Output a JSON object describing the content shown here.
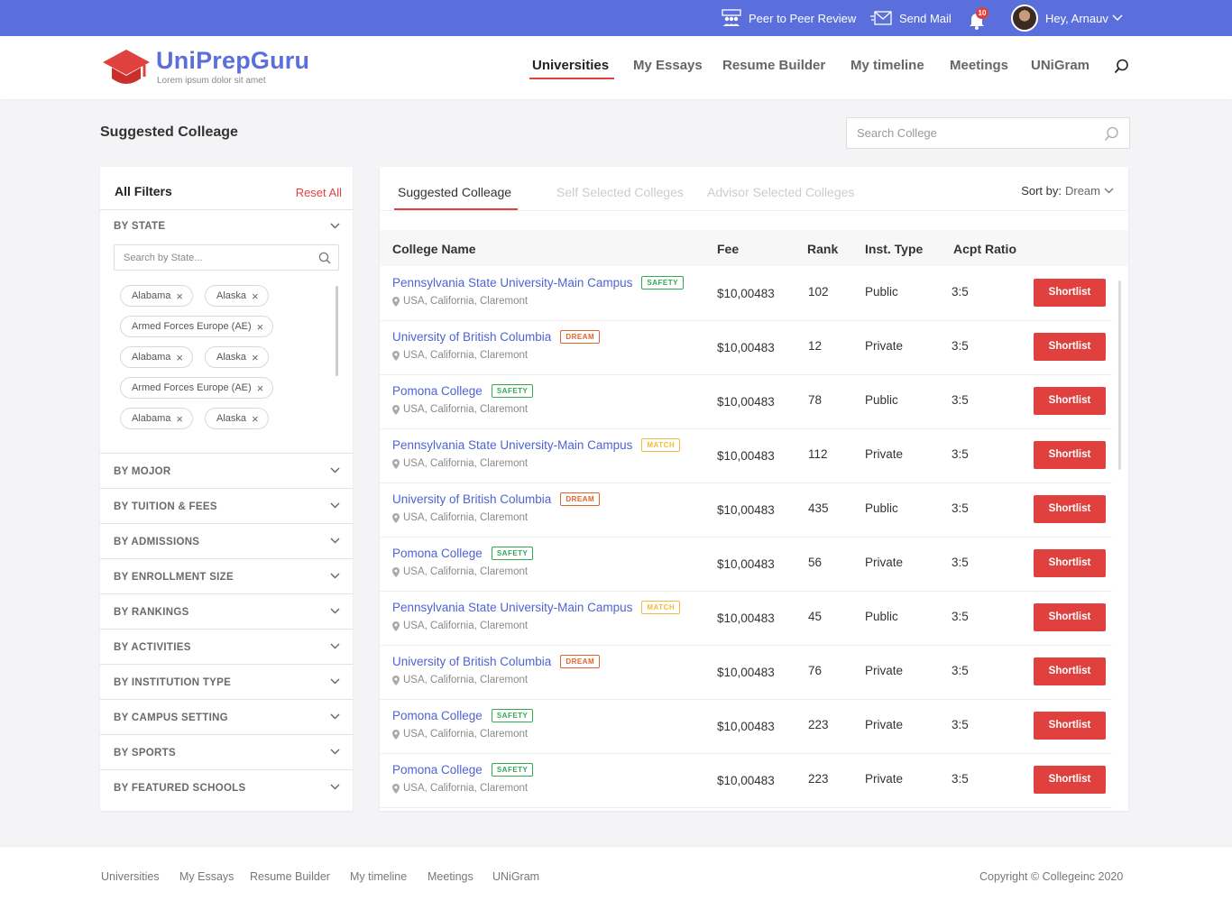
{
  "topbar": {
    "peer_review": "Peer to Peer Review",
    "send_mail": "Send Mail",
    "notif_count": "10",
    "greeting": "Hey, Arnauv"
  },
  "brand": {
    "name": "UniPrepGuru",
    "tagline": "Lorem ipsum dolor sit amet",
    "primary_color": "#5b6fdc",
    "accent_color": "#e0413f"
  },
  "nav": [
    "Universities",
    "My Essays",
    "Resume Builder",
    "My timeline",
    "Meetings",
    "UNiGram"
  ],
  "nav_active": "Universities",
  "page": {
    "title": "Suggested Colleage",
    "search_placeholder": "Search College"
  },
  "filters": {
    "title": "All Filters",
    "reset": "Reset All",
    "state": {
      "label": "BY STATE",
      "search_placeholder": "Search by State...",
      "chips": [
        "Alabama",
        "Alaska",
        "Armed Forces Europe (AE)",
        "Alabama",
        "Alaska",
        "Armed Forces Europe (AE)",
        "Alabama",
        "Alaska"
      ]
    },
    "groups": [
      "BY MOJOR",
      "BY TUITION & FEES",
      "BY ADMISSIONS",
      "BY ENROLLMENT SIZE",
      "BY RANKINGS",
      "BY ACTIVITIES",
      "BY INSTITUTION TYPE",
      "BY CAMPUS SETTING",
      "BY SPORTS",
      "BY FEATURED SCHOOLS"
    ]
  },
  "tabs": [
    "Suggested Colleage",
    "Self Selected Colleges",
    "Advisor Selected Colleges"
  ],
  "sort": {
    "label": "Sort by:",
    "value": "Dream"
  },
  "table": {
    "headers": [
      "College Name",
      "Fee",
      "Rank",
      "Inst. Type",
      "Acpt Ratio"
    ],
    "action_label": "Shortlist",
    "rows": [
      {
        "name": "Pennsylvania State University-Main Campus",
        "tag": "SAFETY",
        "location": "USA, California, Claremont",
        "fee": "$10,00483",
        "rank": "102",
        "type": "Public",
        "ratio": "3:5"
      },
      {
        "name": "University of British Columbia",
        "tag": "DREAM",
        "location": "USA, California, Claremont",
        "fee": "$10,00483",
        "rank": "12",
        "type": "Private",
        "ratio": "3:5"
      },
      {
        "name": "Pomona College",
        "tag": "SAFETY",
        "location": "USA, California, Claremont",
        "fee": "$10,00483",
        "rank": "78",
        "type": "Public",
        "ratio": "3:5"
      },
      {
        "name": "Pennsylvania State University-Main Campus",
        "tag": "MATCH",
        "location": "USA, California, Claremont",
        "fee": "$10,00483",
        "rank": "112",
        "type": "Private",
        "ratio": "3:5"
      },
      {
        "name": "University of British Columbia",
        "tag": "DREAM",
        "location": "USA, California, Claremont",
        "fee": "$10,00483",
        "rank": "435",
        "type": "Public",
        "ratio": "3:5"
      },
      {
        "name": "Pomona College",
        "tag": "SAFETY",
        "location": "USA, California, Claremont",
        "fee": "$10,00483",
        "rank": "56",
        "type": "Private",
        "ratio": "3:5"
      },
      {
        "name": "Pennsylvania State University-Main Campus",
        "tag": "MATCH",
        "location": "USA, California, Claremont",
        "fee": "$10,00483",
        "rank": "45",
        "type": "Public",
        "ratio": "3:5"
      },
      {
        "name": "University of British Columbia",
        "tag": "DREAM",
        "location": "USA, California, Claremont",
        "fee": "$10,00483",
        "rank": "76",
        "type": "Private",
        "ratio": "3:5"
      },
      {
        "name": "Pomona College",
        "tag": "SAFETY",
        "location": "USA, California, Claremont",
        "fee": "$10,00483",
        "rank": "223",
        "type": "Private",
        "ratio": "3:5"
      },
      {
        "name": "Pomona College",
        "tag": "SAFETY",
        "location": "USA, California, Claremont",
        "fee": "$10,00483",
        "rank": "223",
        "type": "Private",
        "ratio": "3:5"
      }
    ]
  },
  "footer": {
    "links": [
      "Universities",
      "My Essays",
      "Resume Builder",
      "My timeline",
      "Meetings",
      "UNiGram"
    ],
    "copyright": "Copyright © Collegeinc 2020"
  }
}
